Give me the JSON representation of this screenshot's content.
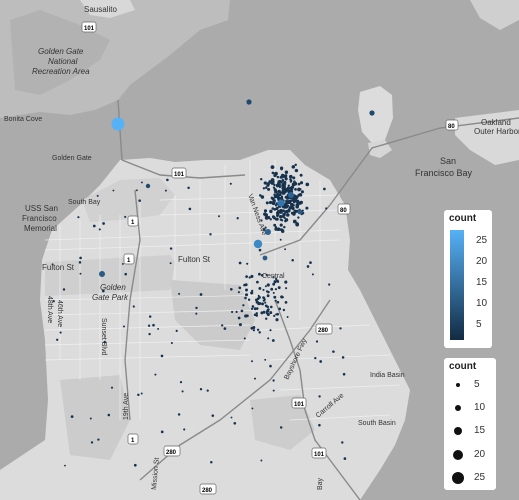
{
  "place_labels": [
    {
      "text": "Sausalito",
      "weight": "normal",
      "italic": false
    },
    {
      "text": "Golden Gate",
      "weight": "normal",
      "italic": true
    },
    {
      "text": "National",
      "weight": "normal",
      "italic": true
    },
    {
      "text": "Recreation Area",
      "weight": "normal",
      "italic": true
    },
    {
      "text": "Bonita Cove",
      "weight": "normal",
      "italic": false
    },
    {
      "text": "Golden Gate",
      "weight": "normal",
      "italic": false
    },
    {
      "text": "South Bay",
      "weight": "normal",
      "italic": false
    },
    {
      "text": "USS San",
      "weight": "normal",
      "italic": false
    },
    {
      "text": "Francisco",
      "weight": "normal",
      "italic": false
    },
    {
      "text": "Memorial",
      "weight": "normal",
      "italic": false
    },
    {
      "text": "Fulton St",
      "weight": "normal",
      "italic": false
    },
    {
      "text": "Fulton St",
      "weight": "normal",
      "italic": false
    },
    {
      "text": "Golden",
      "weight": "normal",
      "italic": true
    },
    {
      "text": "Gate Park",
      "weight": "normal",
      "italic": true
    },
    {
      "text": "46th Ave",
      "weight": "normal",
      "italic": false
    },
    {
      "text": "Sunset Blvd",
      "weight": "normal",
      "italic": false
    },
    {
      "text": "19th Ave",
      "weight": "normal",
      "italic": false
    },
    {
      "text": "Oakland",
      "weight": "normal",
      "italic": false
    },
    {
      "text": "Outer Harbor",
      "weight": "normal",
      "italic": false
    },
    {
      "text": "San",
      "weight": "normal",
      "italic": false
    },
    {
      "text": "Francisco Bay",
      "weight": "normal",
      "italic": false
    },
    {
      "text": "Central",
      "weight": "normal",
      "italic": false
    },
    {
      "text": "India Basin",
      "weight": "normal",
      "italic": false
    },
    {
      "text": "South Basin",
      "weight": "normal",
      "italic": false
    },
    {
      "text": "Carroll Ave",
      "weight": "normal",
      "italic": false
    },
    {
      "text": "Bayshore Fwy",
      "weight": "normal",
      "italic": false
    },
    {
      "text": "Van Ness Ave",
      "weight": "normal",
      "italic": false
    },
    {
      "text": "48th Ave",
      "weight": "normal",
      "italic": false
    },
    {
      "text": "Mission St",
      "weight": "normal",
      "italic": false
    },
    {
      "text": "Bay",
      "weight": "normal",
      "italic": false
    }
  ],
  "road_shields": [
    "101",
    "101",
    "1",
    "1",
    "80",
    "80",
    "280",
    "101",
    "1",
    "280",
    "101",
    "280"
  ],
  "legends": {
    "color": {
      "title": "count",
      "ticks": [
        "25",
        "20",
        "15",
        "10",
        "5"
      ],
      "low_color": "#132b43",
      "high_color": "#56b1f7"
    },
    "size": {
      "title": "count",
      "ticks": [
        "5",
        "10",
        "15",
        "20",
        "25"
      ]
    }
  },
  "colors": {
    "water": "#a9a9a9",
    "land": "#dcdcdc",
    "park": "#d2d2d2",
    "road": "#f4f4f4",
    "highway": "#8c8c8c"
  },
  "points_summary": "Incident locations across San Francisco, clustered heavily in the Tenderloin / Financial District; counts mostly 1–3, a few larger circles up to ~25."
}
